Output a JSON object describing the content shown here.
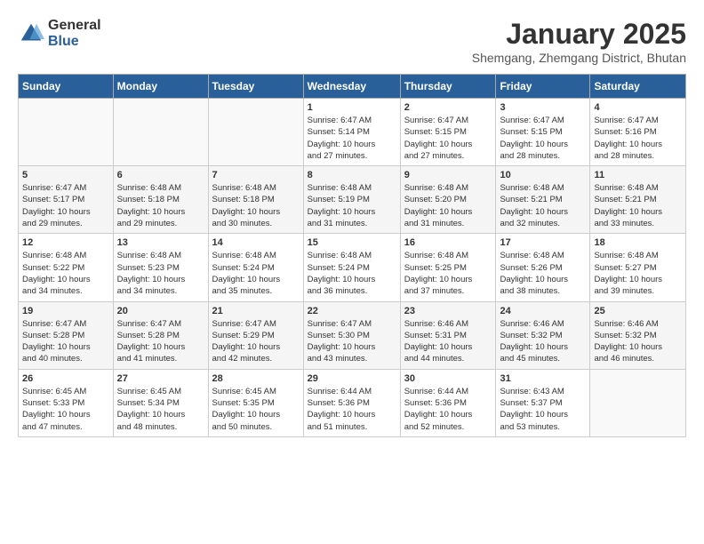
{
  "header": {
    "logo_general": "General",
    "logo_blue": "Blue",
    "month_title": "January 2025",
    "location": "Shemgang, Zhemgang District, Bhutan"
  },
  "weekdays": [
    "Sunday",
    "Monday",
    "Tuesday",
    "Wednesday",
    "Thursday",
    "Friday",
    "Saturday"
  ],
  "weeks": [
    [
      {
        "day": "",
        "info": ""
      },
      {
        "day": "",
        "info": ""
      },
      {
        "day": "",
        "info": ""
      },
      {
        "day": "1",
        "info": "Sunrise: 6:47 AM\nSunset: 5:14 PM\nDaylight: 10 hours\nand 27 minutes."
      },
      {
        "day": "2",
        "info": "Sunrise: 6:47 AM\nSunset: 5:15 PM\nDaylight: 10 hours\nand 27 minutes."
      },
      {
        "day": "3",
        "info": "Sunrise: 6:47 AM\nSunset: 5:15 PM\nDaylight: 10 hours\nand 28 minutes."
      },
      {
        "day": "4",
        "info": "Sunrise: 6:47 AM\nSunset: 5:16 PM\nDaylight: 10 hours\nand 28 minutes."
      }
    ],
    [
      {
        "day": "5",
        "info": "Sunrise: 6:47 AM\nSunset: 5:17 PM\nDaylight: 10 hours\nand 29 minutes."
      },
      {
        "day": "6",
        "info": "Sunrise: 6:48 AM\nSunset: 5:18 PM\nDaylight: 10 hours\nand 29 minutes."
      },
      {
        "day": "7",
        "info": "Sunrise: 6:48 AM\nSunset: 5:18 PM\nDaylight: 10 hours\nand 30 minutes."
      },
      {
        "day": "8",
        "info": "Sunrise: 6:48 AM\nSunset: 5:19 PM\nDaylight: 10 hours\nand 31 minutes."
      },
      {
        "day": "9",
        "info": "Sunrise: 6:48 AM\nSunset: 5:20 PM\nDaylight: 10 hours\nand 31 minutes."
      },
      {
        "day": "10",
        "info": "Sunrise: 6:48 AM\nSunset: 5:21 PM\nDaylight: 10 hours\nand 32 minutes."
      },
      {
        "day": "11",
        "info": "Sunrise: 6:48 AM\nSunset: 5:21 PM\nDaylight: 10 hours\nand 33 minutes."
      }
    ],
    [
      {
        "day": "12",
        "info": "Sunrise: 6:48 AM\nSunset: 5:22 PM\nDaylight: 10 hours\nand 34 minutes."
      },
      {
        "day": "13",
        "info": "Sunrise: 6:48 AM\nSunset: 5:23 PM\nDaylight: 10 hours\nand 34 minutes."
      },
      {
        "day": "14",
        "info": "Sunrise: 6:48 AM\nSunset: 5:24 PM\nDaylight: 10 hours\nand 35 minutes."
      },
      {
        "day": "15",
        "info": "Sunrise: 6:48 AM\nSunset: 5:24 PM\nDaylight: 10 hours\nand 36 minutes."
      },
      {
        "day": "16",
        "info": "Sunrise: 6:48 AM\nSunset: 5:25 PM\nDaylight: 10 hours\nand 37 minutes."
      },
      {
        "day": "17",
        "info": "Sunrise: 6:48 AM\nSunset: 5:26 PM\nDaylight: 10 hours\nand 38 minutes."
      },
      {
        "day": "18",
        "info": "Sunrise: 6:48 AM\nSunset: 5:27 PM\nDaylight: 10 hours\nand 39 minutes."
      }
    ],
    [
      {
        "day": "19",
        "info": "Sunrise: 6:47 AM\nSunset: 5:28 PM\nDaylight: 10 hours\nand 40 minutes."
      },
      {
        "day": "20",
        "info": "Sunrise: 6:47 AM\nSunset: 5:28 PM\nDaylight: 10 hours\nand 41 minutes."
      },
      {
        "day": "21",
        "info": "Sunrise: 6:47 AM\nSunset: 5:29 PM\nDaylight: 10 hours\nand 42 minutes."
      },
      {
        "day": "22",
        "info": "Sunrise: 6:47 AM\nSunset: 5:30 PM\nDaylight: 10 hours\nand 43 minutes."
      },
      {
        "day": "23",
        "info": "Sunrise: 6:46 AM\nSunset: 5:31 PM\nDaylight: 10 hours\nand 44 minutes."
      },
      {
        "day": "24",
        "info": "Sunrise: 6:46 AM\nSunset: 5:32 PM\nDaylight: 10 hours\nand 45 minutes."
      },
      {
        "day": "25",
        "info": "Sunrise: 6:46 AM\nSunset: 5:32 PM\nDaylight: 10 hours\nand 46 minutes."
      }
    ],
    [
      {
        "day": "26",
        "info": "Sunrise: 6:45 AM\nSunset: 5:33 PM\nDaylight: 10 hours\nand 47 minutes."
      },
      {
        "day": "27",
        "info": "Sunrise: 6:45 AM\nSunset: 5:34 PM\nDaylight: 10 hours\nand 48 minutes."
      },
      {
        "day": "28",
        "info": "Sunrise: 6:45 AM\nSunset: 5:35 PM\nDaylight: 10 hours\nand 50 minutes."
      },
      {
        "day": "29",
        "info": "Sunrise: 6:44 AM\nSunset: 5:36 PM\nDaylight: 10 hours\nand 51 minutes."
      },
      {
        "day": "30",
        "info": "Sunrise: 6:44 AM\nSunset: 5:36 PM\nDaylight: 10 hours\nand 52 minutes."
      },
      {
        "day": "31",
        "info": "Sunrise: 6:43 AM\nSunset: 5:37 PM\nDaylight: 10 hours\nand 53 minutes."
      },
      {
        "day": "",
        "info": ""
      }
    ]
  ]
}
